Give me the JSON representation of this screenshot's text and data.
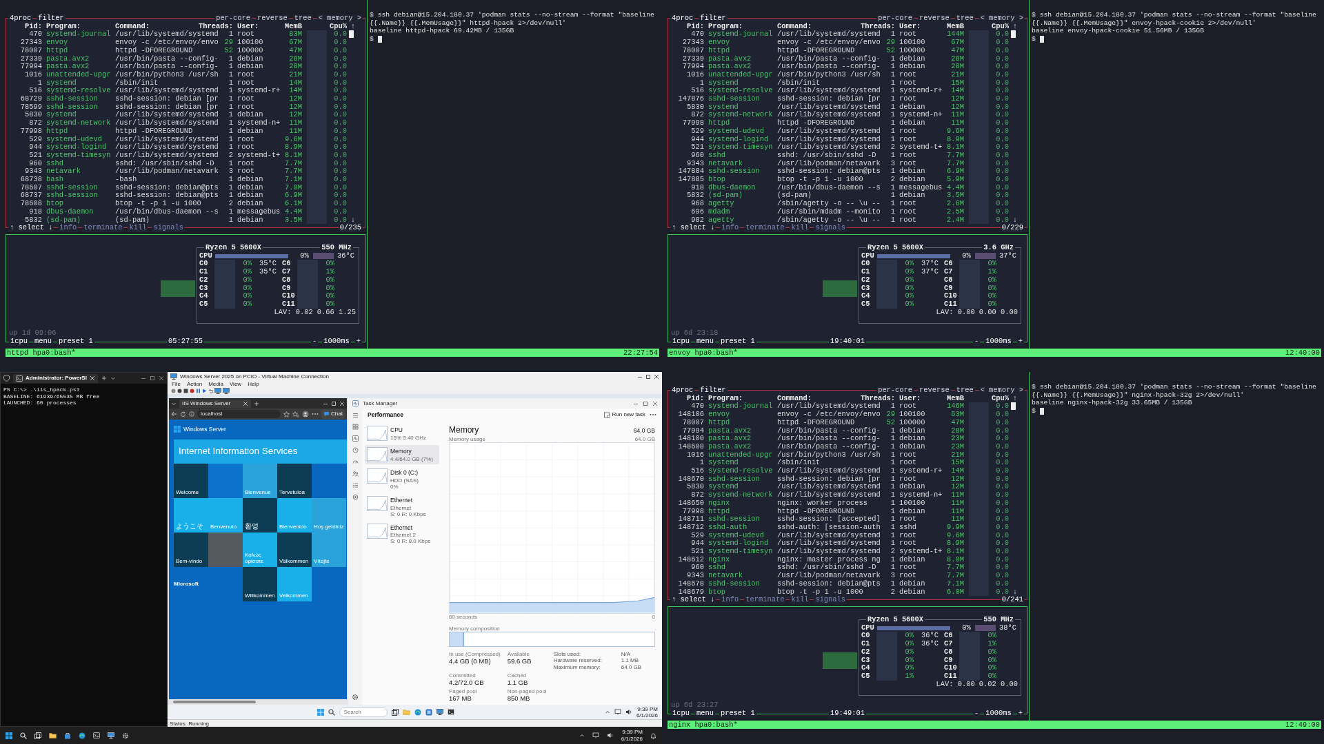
{
  "screens": [
    {
      "kind": "tmux",
      "btop": {
        "header_left": [
          "4proc",
          "filter"
        ],
        "header_right": [
          "per-core",
          "reverse",
          "tree",
          "< memory >"
        ],
        "columns": [
          "Pid:",
          "Program:",
          "Command:",
          "Threads:",
          "User:",
          "MemB",
          "Cpu%"
        ],
        "scroll_up": "↑",
        "scroll_down": "↓",
        "processes": [
          {
            "pid": "470",
            "program": "systemd-journal",
            "command": "/usr/lib/systemd/systemd",
            "threads": "1",
            "user": "root",
            "mem": "83M",
            "cpu": "0.0"
          },
          {
            "pid": "27343",
            "program": "envoy",
            "command": "envoy -c /etc/envoy/envo",
            "threads": "29",
            "user": "100100",
            "mem": "67M",
            "cpu": "0.0"
          },
          {
            "pid": "78007",
            "program": "httpd",
            "command": "httpd -DFOREGROUND",
            "threads": "52",
            "user": "100000",
            "mem": "47M",
            "cpu": "0.0"
          },
          {
            "pid": "27339",
            "program": "pasta.avx2",
            "command": "/usr/bin/pasta --config-",
            "threads": "1",
            "user": "debian",
            "mem": "28M",
            "cpu": "0.0"
          },
          {
            "pid": "77994",
            "program": "pasta.avx2",
            "command": "/usr/bin/pasta --config-",
            "threads": "1",
            "user": "debian",
            "mem": "28M",
            "cpu": "0.0"
          },
          {
            "pid": "1016",
            "program": "unattended-upgr",
            "command": "/usr/bin/python3 /usr/sh",
            "threads": "1",
            "user": "root",
            "mem": "21M",
            "cpu": "0.0"
          },
          {
            "pid": "1",
            "program": "systemd",
            "command": "/sbin/init",
            "threads": "1",
            "user": "root",
            "mem": "14M",
            "cpu": "0.0"
          },
          {
            "pid": "516",
            "program": "systemd-resolve",
            "command": "/usr/lib/systemd/systemd",
            "threads": "1",
            "user": "systemd-r+",
            "mem": "14M",
            "cpu": "0.0"
          },
          {
            "pid": "68729",
            "program": "sshd-session",
            "command": "sshd-session: debian [pr",
            "threads": "1",
            "user": "root",
            "mem": "12M",
            "cpu": "0.0"
          },
          {
            "pid": "78599",
            "program": "sshd-session",
            "command": "sshd-session: debian [pr",
            "threads": "1",
            "user": "root",
            "mem": "12M",
            "cpu": "0.0"
          },
          {
            "pid": "5830",
            "program": "systemd",
            "command": "/usr/lib/systemd/systemd",
            "threads": "1",
            "user": "debian",
            "mem": "12M",
            "cpu": "0.0"
          },
          {
            "pid": "872",
            "program": "systemd-network",
            "command": "/usr/lib/systemd/systemd",
            "threads": "1",
            "user": "systemd-n+",
            "mem": "11M",
            "cpu": "0.0"
          },
          {
            "pid": "77998",
            "program": "httpd",
            "command": "httpd -DFOREGROUND",
            "threads": "1",
            "user": "debian",
            "mem": "11M",
            "cpu": "0.0"
          },
          {
            "pid": "529",
            "program": "systemd-udevd",
            "command": "/usr/lib/systemd/systemd",
            "threads": "1",
            "user": "root",
            "mem": "9.6M",
            "cpu": "0.0"
          },
          {
            "pid": "944",
            "program": "systemd-logind",
            "command": "/usr/lib/systemd/systemd",
            "threads": "1",
            "user": "root",
            "mem": "8.9M",
            "cpu": "0.0"
          },
          {
            "pid": "521",
            "program": "systemd-timesyn",
            "command": "/usr/lib/systemd/systemd",
            "threads": "2",
            "user": "systemd-t+",
            "mem": "8.1M",
            "cpu": "0.0"
          },
          {
            "pid": "960",
            "program": "sshd",
            "command": "sshd: /usr/sbin/sshd -D",
            "threads": "1",
            "user": "root",
            "mem": "7.7M",
            "cpu": "0.0"
          },
          {
            "pid": "9343",
            "program": "netavark",
            "command": "/usr/lib/podman/netavark",
            "threads": "3",
            "user": "root",
            "mem": "7.7M",
            "cpu": "0.0"
          },
          {
            "pid": "68738",
            "program": "bash",
            "command": "-bash",
            "threads": "1",
            "user": "debian",
            "mem": "7.1M",
            "cpu": "0.0"
          },
          {
            "pid": "78607",
            "program": "sshd-session",
            "command": "sshd-session: debian@pts",
            "threads": "1",
            "user": "debian",
            "mem": "7.0M",
            "cpu": "0.0"
          },
          {
            "pid": "68737",
            "program": "sshd-session",
            "command": "sshd-session: debian@pts",
            "threads": "1",
            "user": "debian",
            "mem": "6.9M",
            "cpu": "0.0"
          },
          {
            "pid": "78608",
            "program": "btop",
            "command": "btop -t -p 1 -u 1000",
            "threads": "2",
            "user": "debian",
            "mem": "6.1M",
            "cpu": "0.0"
          },
          {
            "pid": "918",
            "program": "dbus-daemon",
            "command": "/usr/bin/dbus-daemon --s",
            "threads": "1",
            "user": "messagebus",
            "mem": "4.4M",
            "cpu": "0.0"
          },
          {
            "pid": "5832",
            "program": "(sd-pam)",
            "command": "(sd-pam)",
            "threads": "1",
            "user": "debian",
            "mem": "3.5M",
            "cpu": "0.0"
          }
        ],
        "footer": [
          "↑ select ↓",
          "info",
          "terminate",
          "kill",
          "signals"
        ],
        "count": "0/235",
        "cpu": {
          "model": "Ryzen 5 5600X",
          "freq": "550 MHz",
          "label": "CPU",
          "total": "0%",
          "temp": "36°C",
          "cores": [
            {
              "name": "C0",
              "value": "0%",
              "temp": "35°C"
            },
            {
              "name": "C1",
              "value": "0%",
              "temp": "35°C"
            },
            {
              "name": "C2",
              "value": "0%"
            },
            {
              "name": "C3",
              "value": "0%"
            },
            {
              "name": "C4",
              "value": "0%"
            },
            {
              "name": "C5",
              "value": "0%"
            },
            {
              "name": "C6",
              "value": "0%"
            },
            {
              "name": "C7",
              "value": "1%"
            },
            {
              "name": "C8",
              "value": "0%"
            },
            {
              "name": "C9",
              "value": "0%"
            },
            {
              "name": "C10",
              "value": "0%"
            },
            {
              "name": "C11",
              "value": "0%"
            }
          ],
          "lav": "LAV: 0.02 0.66 1.25",
          "uptime": "up 1d 09:06",
          "tabs": [
            "1cpu",
            "menu",
            "preset 1"
          ],
          "clock": "05:27:55",
          "minus": "-",
          "interval": "1000ms",
          "plus": "+"
        }
      },
      "shell": {
        "lines": [
          "$ ssh debian@15.204.180.37 'podman stats --no-stream --format \"baseline",
          "{{.Name}} {{.MemUsage}}\" httpd-hpack 2>/dev/null'",
          "baseline httpd-hpack 69.42MB / 135GB"
        ],
        "prompt": "$",
        "cursor": true
      },
      "status": {
        "session": "httpd hpa0:bash*",
        "time": "22:27:54"
      }
    },
    {
      "kind": "tmux",
      "btop": {
        "header_left": [
          "4proc",
          "filter"
        ],
        "header_right": [
          "per-core",
          "reverse",
          "tree",
          "< memory >"
        ],
        "columns": [
          "Pid:",
          "Program:",
          "Command:",
          "Threads:",
          "User:",
          "MemB",
          "Cpu%"
        ],
        "scroll_up": "↑",
        "scroll_down": "↓",
        "processes": [
          {
            "pid": "470",
            "program": "systemd-journal",
            "command": "/usr/lib/systemd/systemd",
            "threads": "1",
            "user": "root",
            "mem": "144M",
            "cpu": "0.0"
          },
          {
            "pid": "27343",
            "program": "envoy",
            "command": "envoy -c /etc/envoy/envo",
            "threads": "29",
            "user": "100100",
            "mem": "67M",
            "cpu": "0.0"
          },
          {
            "pid": "78007",
            "program": "httpd",
            "command": "httpd -DFOREGROUND",
            "threads": "52",
            "user": "100000",
            "mem": "47M",
            "cpu": "0.0"
          },
          {
            "pid": "27339",
            "program": "pasta.avx2",
            "command": "/usr/bin/pasta --config-",
            "threads": "1",
            "user": "debian",
            "mem": "28M",
            "cpu": "0.0"
          },
          {
            "pid": "77994",
            "program": "pasta.avx2",
            "command": "/usr/bin/pasta --config-",
            "threads": "1",
            "user": "debian",
            "mem": "28M",
            "cpu": "0.0"
          },
          {
            "pid": "1016",
            "program": "unattended-upgr",
            "command": "/usr/bin/python3 /usr/sh",
            "threads": "1",
            "user": "root",
            "mem": "21M",
            "cpu": "0.0"
          },
          {
            "pid": "1",
            "program": "systemd",
            "command": "/sbin/init",
            "threads": "1",
            "user": "root",
            "mem": "15M",
            "cpu": "0.0"
          },
          {
            "pid": "516",
            "program": "systemd-resolve",
            "command": "/usr/lib/systemd/systemd",
            "threads": "1",
            "user": "systemd-r+",
            "mem": "14M",
            "cpu": "0.0"
          },
          {
            "pid": "147876",
            "program": "sshd-session",
            "command": "sshd-session: debian [pr",
            "threads": "1",
            "user": "root",
            "mem": "12M",
            "cpu": "0.0"
          },
          {
            "pid": "5830",
            "program": "systemd",
            "command": "/usr/lib/systemd/systemd",
            "threads": "1",
            "user": "debian",
            "mem": "12M",
            "cpu": "0.0"
          },
          {
            "pid": "872",
            "program": "systemd-network",
            "command": "/usr/lib/systemd/systemd",
            "threads": "1",
            "user": "systemd-n+",
            "mem": "11M",
            "cpu": "0.0"
          },
          {
            "pid": "77998",
            "program": "httpd",
            "command": "httpd -DFOREGROUND",
            "threads": "1",
            "user": "debian",
            "mem": "11M",
            "cpu": "0.0"
          },
          {
            "pid": "529",
            "program": "systemd-udevd",
            "command": "/usr/lib/systemd/systemd",
            "threads": "1",
            "user": "root",
            "mem": "9.6M",
            "cpu": "0.0"
          },
          {
            "pid": "944",
            "program": "systemd-logind",
            "command": "/usr/lib/systemd/systemd",
            "threads": "1",
            "user": "root",
            "mem": "8.9M",
            "cpu": "0.0"
          },
          {
            "pid": "521",
            "program": "systemd-timesyn",
            "command": "/usr/lib/systemd/systemd",
            "threads": "2",
            "user": "systemd-t+",
            "mem": "8.1M",
            "cpu": "0.0"
          },
          {
            "pid": "960",
            "program": "sshd",
            "command": "sshd: /usr/sbin/sshd -D",
            "threads": "1",
            "user": "root",
            "mem": "7.7M",
            "cpu": "0.0"
          },
          {
            "pid": "9343",
            "program": "netavark",
            "command": "/usr/lib/podman/netavark",
            "threads": "3",
            "user": "root",
            "mem": "7.7M",
            "cpu": "0.0"
          },
          {
            "pid": "147884",
            "program": "sshd-session",
            "command": "sshd-session: debian@pts",
            "threads": "1",
            "user": "debian",
            "mem": "6.9M",
            "cpu": "0.0"
          },
          {
            "pid": "147885",
            "program": "btop",
            "command": "btop -t -p 1 -u 1000",
            "threads": "2",
            "user": "debian",
            "mem": "5.9M",
            "cpu": "0.0"
          },
          {
            "pid": "918",
            "program": "dbus-daemon",
            "command": "/usr/bin/dbus-daemon --s",
            "threads": "1",
            "user": "messagebus",
            "mem": "4.4M",
            "cpu": "0.0"
          },
          {
            "pid": "5832",
            "program": "(sd-pam)",
            "command": "(sd-pam)",
            "threads": "1",
            "user": "debian",
            "mem": "3.5M",
            "cpu": "0.0"
          },
          {
            "pid": "968",
            "program": "agetty",
            "command": "/sbin/agetty -o -- \\u --",
            "threads": "1",
            "user": "root",
            "mem": "2.6M",
            "cpu": "0.0"
          },
          {
            "pid": "696",
            "program": "mdadm",
            "command": "/usr/sbin/mdadm --monito",
            "threads": "1",
            "user": "root",
            "mem": "2.5M",
            "cpu": "0.0"
          },
          {
            "pid": "982",
            "program": "agetty",
            "command": "/sbin/agetty -o -- \\u --",
            "threads": "1",
            "user": "root",
            "mem": "2.4M",
            "cpu": "0.0"
          }
        ],
        "footer": [
          "↑ select ↓",
          "info",
          "terminate",
          "kill",
          "signals"
        ],
        "count": "0/229",
        "cpu": {
          "model": "Ryzen 5 5600X",
          "freq": "3.6 GHz",
          "label": "CPU",
          "total": "0%",
          "temp": "37°C",
          "cores": [
            {
              "name": "C0",
              "value": "0%",
              "temp": "37°C"
            },
            {
              "name": "C1",
              "value": "0%",
              "temp": "37°C"
            },
            {
              "name": "C2",
              "value": "0%"
            },
            {
              "name": "C3",
              "value": "0%"
            },
            {
              "name": "C4",
              "value": "0%"
            },
            {
              "name": "C5",
              "value": "0%"
            },
            {
              "name": "C6",
              "value": "0%"
            },
            {
              "name": "C7",
              "value": "1%"
            },
            {
              "name": "C8",
              "value": "0%"
            },
            {
              "name": "C9",
              "value": "0%"
            },
            {
              "name": "C10",
              "value": "0%"
            },
            {
              "name": "C11",
              "value": "0%"
            }
          ],
          "lav": "LAV: 0.00 0.00 0.00",
          "uptime": "up 6d 23:18",
          "tabs": [
            "1cpu",
            "menu",
            "preset 1"
          ],
          "clock": "19:40:01",
          "minus": "-",
          "interval": "1000ms",
          "plus": "+"
        }
      },
      "shell": {
        "lines": [
          "$ ssh debian@15.204.180.37 'podman stats --no-stream --format \"baseline",
          "{{.Name}} {{.MemUsage}}\" envoy-hpack-cookie 2>/dev/null'",
          "baseline envoy-hpack-cookie 51.56MB / 135GB"
        ],
        "prompt": "$",
        "cursor": true
      },
      "status": {
        "session": "envoy hpa0:bash*",
        "time": "12:40:00"
      }
    },
    {
      "kind": "windows",
      "powershell": {
        "tab": "Administrator: PowerSl",
        "lines": [
          "PS C:\\> .\\iis_hpack.ps1",
          "BASELINE: 61939/65535 MB free",
          "LAUNCHED: 60 processes"
        ]
      },
      "vm": {
        "title": "Windows Server 2025 on PCIO - Virtual Machine Connection",
        "menu": [
          "File",
          "Action",
          "Media",
          "View",
          "Help"
        ],
        "status": "Status: Running",
        "browser": {
          "tab": "IIS Windows Server",
          "address": "localhost",
          "chat": "Chat",
          "brand": "Windows Server",
          "banner": "Internet Information Services",
          "tiles": [
            {
              "kind": "text",
              "text": "Welcome",
              "color": "#0d3c55"
            },
            {
              "kind": "plain",
              "color": "#0c73cc"
            },
            {
              "kind": "text",
              "text": "Bienvenue",
              "color": "#2aa3da"
            },
            {
              "kind": "text",
              "text": "Tervetuloa",
              "color": "#0d3c55"
            },
            {
              "kind": "text",
              "text": "ようこそ",
              "color": "#19b0ea"
            },
            {
              "kind": "text",
              "text": "Benvenuto",
              "color": "#19b0ea"
            },
            {
              "kind": "text",
              "text": "환영",
              "color": "#0d3c55"
            },
            {
              "kind": "text",
              "text": "Bienvenido",
              "color": "#19b0ea"
            },
            {
              "kind": "text",
              "text": "Hoş geldiniz",
              "color": "#2aa3da"
            },
            {
              "kind": "text",
              "text": "Bem-vindo",
              "color": "#0d3c55"
            },
            {
              "kind": "photo"
            },
            {
              "kind": "text",
              "text": "Καλώς ορίσατε",
              "color": "#19b0ea"
            },
            {
              "kind": "text",
              "text": "Välkommen",
              "color": "#0d3c55"
            },
            {
              "kind": "text",
              "text": "Vítejte",
              "color": "#2aa3da"
            },
            {
              "kind": "text",
              "text": "Willkommen",
              "color": "#0d3c55"
            },
            {
              "kind": "text",
              "text": "Velkommen",
              "color": "#19b0ea"
            }
          ],
          "footer": "Microsoft"
        },
        "task_manager": {
          "title": "Task Manager",
          "section": "Performance",
          "run_task": "Run new task",
          "devices": [
            {
              "name": "CPU",
              "detail": [
                "15% 5.40 GHz"
              ],
              "selected": false
            },
            {
              "name": "Memory",
              "detail": [
                "4.4/64.0 GB (7%)"
              ],
              "selected": true
            },
            {
              "name": "Disk 0 (C:)",
              "detail": [
                "HDD (SAS)",
                "0%"
              ],
              "selected": false
            },
            {
              "name": "Ethernet",
              "detail": [
                "Ethernet",
                "S: 0 R: 0 Kbps"
              ],
              "selected": false
            },
            {
              "name": "Ethernet",
              "detail": [
                "Ethernet 2",
                "S: 0 R: 8.0 Kbps"
              ],
              "selected": false
            }
          ],
          "heading": "Memory",
          "capacity": "64.0 GB",
          "usage_label": "Memory usage",
          "usage_max": "64.0 GB",
          "time_span": "60 seconds",
          "time_end": "0",
          "composition_label": "Memory composition",
          "composition": {
            "level": 0.07
          },
          "stats": [
            {
              "label": "In use (Compressed)",
              "value": "4.4 GB (0 MB)"
            },
            {
              "label": "Available",
              "value": "59.6 GB"
            },
            {
              "label": "Committed",
              "value": "4.2/72.0 GB"
            },
            {
              "label": "Cached",
              "value": "1.1 GB"
            },
            {
              "label": "Paged pool",
              "value": "167 MB"
            },
            {
              "label": "Non-paged pool",
              "value": "850 MB"
            }
          ],
          "specs": [
            {
              "label": "Slots used:",
              "value": "N/A"
            },
            {
              "label": "Hardware reserved:",
              "value": "1.1 MB"
            },
            {
              "label": "Maximum memory:",
              "value": "64.0 GB"
            }
          ]
        },
        "taskbar": {
          "placeholder": "Search",
          "time": "9:39 PM",
          "date": "6/1/2026"
        }
      },
      "taskbar": {
        "time": "9:39 PM",
        "date": "6/1/2026"
      }
    },
    {
      "kind": "tmux",
      "btop": {
        "header_left": [
          "4proc",
          "filter"
        ],
        "header_right": [
          "per-core",
          "reverse",
          "tree",
          "< memory >"
        ],
        "columns": [
          "Pid:",
          "Program:",
          "Command:",
          "Threads:",
          "User:",
          "MemB",
          "Cpu%"
        ],
        "scroll_up": "↑",
        "scroll_down": "↓",
        "processes": [
          {
            "pid": "470",
            "program": "systemd-journal",
            "command": "/usr/lib/systemd/systemd",
            "threads": "1",
            "user": "root",
            "mem": "146M",
            "cpu": "0.0"
          },
          {
            "pid": "148106",
            "program": "envoy",
            "command": "envoy -c /etc/envoy/envo",
            "threads": "29",
            "user": "100100",
            "mem": "63M",
            "cpu": "0.0"
          },
          {
            "pid": "78007",
            "program": "httpd",
            "command": "httpd -DFOREGROUND",
            "threads": "52",
            "user": "100000",
            "mem": "47M",
            "cpu": "0.0"
          },
          {
            "pid": "77994",
            "program": "pasta.avx2",
            "command": "/usr/bin/pasta --config-",
            "threads": "1",
            "user": "debian",
            "mem": "28M",
            "cpu": "0.0"
          },
          {
            "pid": "148100",
            "program": "pasta.avx2",
            "command": "/usr/bin/pasta --config-",
            "threads": "1",
            "user": "debian",
            "mem": "23M",
            "cpu": "0.0"
          },
          {
            "pid": "148608",
            "program": "pasta.avx2",
            "command": "/usr/bin/pasta --config-",
            "threads": "1",
            "user": "debian",
            "mem": "23M",
            "cpu": "0.0"
          },
          {
            "pid": "1016",
            "program": "unattended-upgr",
            "command": "/usr/bin/python3 /usr/sh",
            "threads": "1",
            "user": "root",
            "mem": "21M",
            "cpu": "0.0"
          },
          {
            "pid": "1",
            "program": "systemd",
            "command": "/sbin/init",
            "threads": "1",
            "user": "root",
            "mem": "15M",
            "cpu": "0.0"
          },
          {
            "pid": "516",
            "program": "systemd-resolve",
            "command": "/usr/lib/systemd/systemd",
            "threads": "1",
            "user": "systemd-r+",
            "mem": "14M",
            "cpu": "0.0"
          },
          {
            "pid": "148670",
            "program": "sshd-session",
            "command": "sshd-session: debian [pr",
            "threads": "1",
            "user": "root",
            "mem": "12M",
            "cpu": "0.0"
          },
          {
            "pid": "5830",
            "program": "systemd",
            "command": "/usr/lib/systemd/systemd",
            "threads": "1",
            "user": "debian",
            "mem": "12M",
            "cpu": "0.0"
          },
          {
            "pid": "872",
            "program": "systemd-network",
            "command": "/usr/lib/systemd/systemd",
            "threads": "1",
            "user": "systemd-n+",
            "mem": "11M",
            "cpu": "0.0"
          },
          {
            "pid": "148650",
            "program": "nginx",
            "command": "nginx: worker process",
            "threads": "1",
            "user": "100100",
            "mem": "11M",
            "cpu": "0.0"
          },
          {
            "pid": "77998",
            "program": "httpd",
            "command": "httpd -DFOREGROUND",
            "threads": "1",
            "user": "debian",
            "mem": "11M",
            "cpu": "0.0"
          },
          {
            "pid": "148711",
            "program": "sshd-session",
            "command": "sshd-session: [accepted]",
            "threads": "1",
            "user": "root",
            "mem": "11M",
            "cpu": "0.0"
          },
          {
            "pid": "148712",
            "program": "sshd-auth",
            "command": "sshd-auth: [session-auth",
            "threads": "1",
            "user": "sshd",
            "mem": "9.9M",
            "cpu": "0.0"
          },
          {
            "pid": "529",
            "program": "systemd-udevd",
            "command": "/usr/lib/systemd/systemd",
            "threads": "1",
            "user": "root",
            "mem": "9.6M",
            "cpu": "0.0"
          },
          {
            "pid": "944",
            "program": "systemd-logind",
            "command": "/usr/lib/systemd/systemd",
            "threads": "1",
            "user": "root",
            "mem": "8.9M",
            "cpu": "0.0"
          },
          {
            "pid": "521",
            "program": "systemd-timesyn",
            "command": "/usr/lib/systemd/systemd",
            "threads": "2",
            "user": "systemd-t+",
            "mem": "8.1M",
            "cpu": "0.0"
          },
          {
            "pid": "148612",
            "program": "nginx",
            "command": "nginx: master process ng",
            "threads": "1",
            "user": "debian",
            "mem": "8.0M",
            "cpu": "0.0"
          },
          {
            "pid": "960",
            "program": "sshd",
            "command": "sshd: /usr/sbin/sshd -D",
            "threads": "1",
            "user": "root",
            "mem": "7.7M",
            "cpu": "0.0"
          },
          {
            "pid": "9343",
            "program": "netavark",
            "command": "/usr/lib/podman/netavark",
            "threads": "3",
            "user": "root",
            "mem": "7.7M",
            "cpu": "0.0"
          },
          {
            "pid": "148678",
            "program": "sshd-session",
            "command": "sshd-session: debian@pts",
            "threads": "1",
            "user": "debian",
            "mem": "7.1M",
            "cpu": "0.0"
          },
          {
            "pid": "148679",
            "program": "btop",
            "command": "btop -t -p 1 -u 1000",
            "threads": "2",
            "user": "debian",
            "mem": "6.0M",
            "cpu": "0.0"
          }
        ],
        "footer": [
          "↑ select ↓",
          "info",
          "terminate",
          "kill",
          "signals"
        ],
        "count": "0/241",
        "cpu": {
          "model": "Ryzen 5 5600X",
          "freq": "550 MHz",
          "label": "CPU",
          "total": "0%",
          "temp": "38°C",
          "cores": [
            {
              "name": "C0",
              "value": "0%",
              "temp": "36°C"
            },
            {
              "name": "C1",
              "value": "0%",
              "temp": "36°C"
            },
            {
              "name": "C2",
              "value": "0%"
            },
            {
              "name": "C3",
              "value": "0%"
            },
            {
              "name": "C4",
              "value": "0%"
            },
            {
              "name": "C5",
              "value": "1%"
            },
            {
              "name": "C6",
              "value": "0%"
            },
            {
              "name": "C7",
              "value": "1%"
            },
            {
              "name": "C8",
              "value": "0%"
            },
            {
              "name": "C9",
              "value": "0%"
            },
            {
              "name": "C10",
              "value": "0%"
            },
            {
              "name": "C11",
              "value": "0%"
            }
          ],
          "lav": "LAV: 0.00 0.02 0.00",
          "uptime": "up 6d 23:27",
          "tabs": [
            "1cpu",
            "menu",
            "preset 1"
          ],
          "clock": "19:49:01",
          "minus": "-",
          "interval": "1000ms",
          "plus": "+"
        }
      },
      "shell": {
        "lines": [
          "$ ssh debian@15.204.180.37 'podman stats --no-stream --format \"baseline",
          "{{.Name}} {{.MemUsage}}\" nginx-hpack-32g 2>/dev/null'",
          "baseline nginx-hpack-32g 33.65MB / 135GB"
        ],
        "prompt": "$",
        "cursor": true
      },
      "status": {
        "session": "nginx hpa0:bash*",
        "time": "12:49:00"
      }
    }
  ]
}
